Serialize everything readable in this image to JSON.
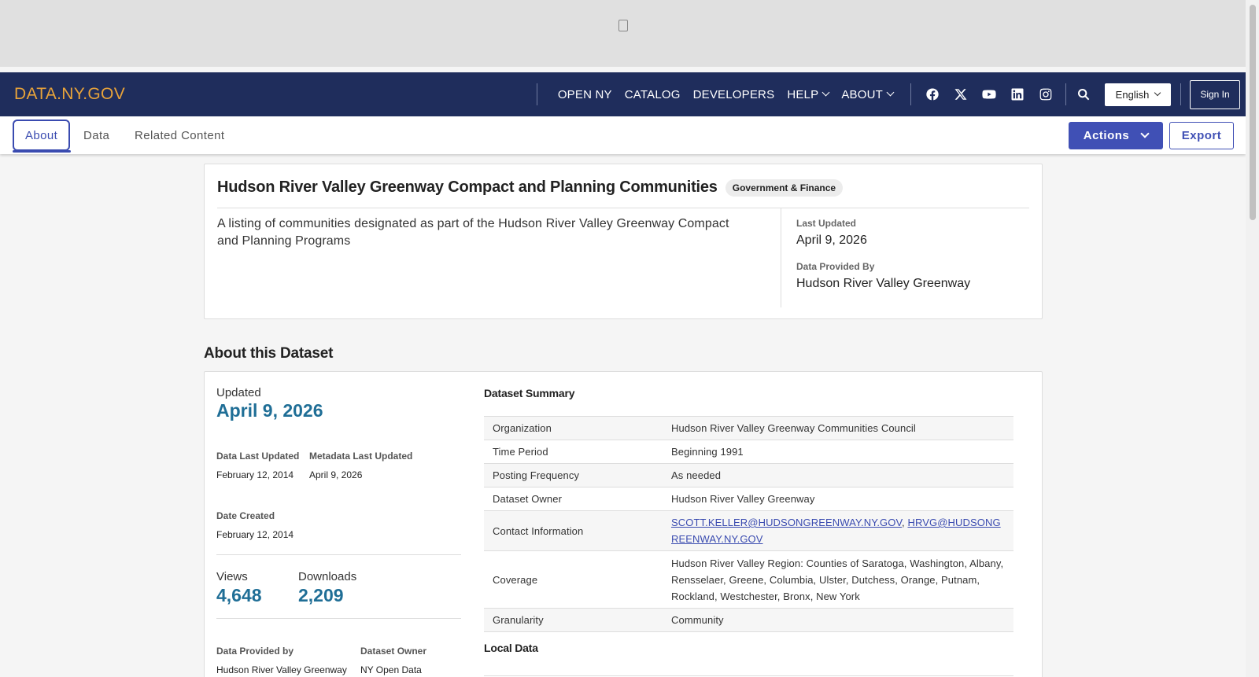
{
  "nav": {
    "brand": "DATA.NY.GOV",
    "links": [
      {
        "label": "OPEN NY",
        "has_menu": false
      },
      {
        "label": "CATALOG",
        "has_menu": false
      },
      {
        "label": "DEVELOPERS",
        "has_menu": false
      },
      {
        "label": "HELP",
        "has_menu": true
      },
      {
        "label": "ABOUT",
        "has_menu": true
      }
    ],
    "social_icons": [
      "facebook-icon",
      "x-twitter-icon",
      "youtube-icon",
      "linkedin-icon",
      "instagram-icon"
    ],
    "language": "English",
    "sign_in": "Sign In"
  },
  "tabs": [
    {
      "label": "About",
      "active": true
    },
    {
      "label": "Data",
      "active": false
    },
    {
      "label": "Related Content",
      "active": false
    }
  ],
  "actions_label": "Actions",
  "export_label": "Export",
  "hero": {
    "title": "Hudson River Valley Greenway Compact and Planning Communities",
    "category": "Government & Finance",
    "description": "A listing of communities designated as part of the Hudson River Valley Greenway Compact and Planning Programs",
    "last_updated_label": "Last Updated",
    "last_updated": "April 9, 2026",
    "provided_by_label": "Data Provided By",
    "provided_by": "Hudson River Valley Greenway"
  },
  "about": {
    "section_title": "About this Dataset",
    "updated_label": "Updated",
    "updated": "April 9, 2026",
    "data_last_updated_label": "Data Last Updated",
    "data_last_updated": "February 12, 2014",
    "metadata_last_updated_label": "Metadata Last Updated",
    "metadata_last_updated": "April 9, 2026",
    "date_created_label": "Date Created",
    "date_created": "February 12, 2014",
    "views_label": "Views",
    "views": "4,648",
    "downloads_label": "Downloads",
    "downloads": "2,209",
    "data_provided_by_label": "Data Provided by",
    "data_provided_by": "Hudson River Valley Greenway",
    "dataset_owner_label": "Dataset Owner",
    "dataset_owner": "NY Open Data"
  },
  "summary": {
    "heading": "Dataset Summary",
    "rows": [
      {
        "key": "Organization",
        "value": "Hudson River Valley Greenway Communities Council"
      },
      {
        "key": "Time Period",
        "value": "Beginning 1991"
      },
      {
        "key": "Posting Frequency",
        "value": "As needed"
      },
      {
        "key": "Dataset Owner",
        "value": "Hudson River Valley Greenway"
      },
      {
        "key": "Contact Information",
        "links": [
          "SCOTT.KELLER@HUDSONGREENWAY.NY.GOV",
          "HRVG@HUDSONGREENWAY.NY.GOV"
        ],
        "link_separator": ", "
      },
      {
        "key": "Coverage",
        "value": "Hudson River Valley Region: Counties of Saratoga, Washington, Albany, Rensselaer, Greene, Columbia, Ulster, Dutchess, Orange, Putnam, Rockland, Westchester, Bronx, New York"
      },
      {
        "key": "Granularity",
        "value": "Community"
      }
    ],
    "local_data_heading": "Local Data"
  }
}
